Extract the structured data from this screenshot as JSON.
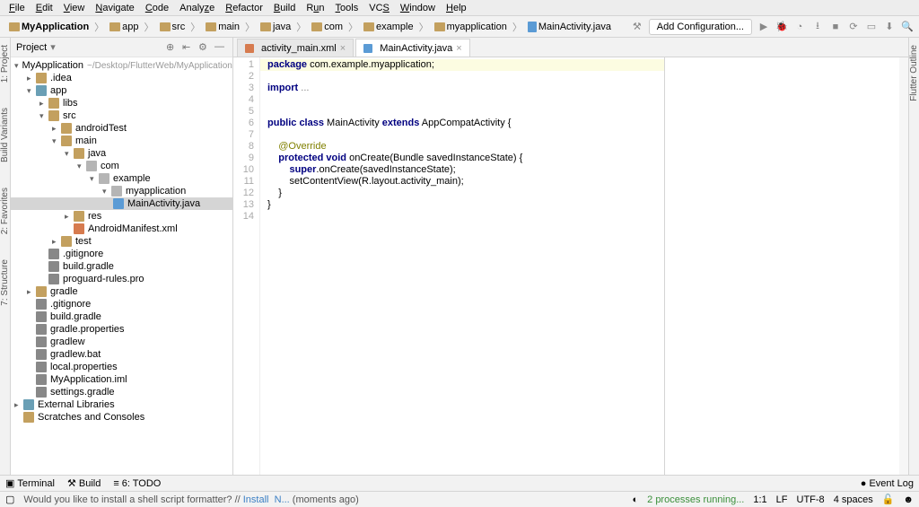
{
  "menu": [
    "File",
    "Edit",
    "View",
    "Navigate",
    "Code",
    "Analyze",
    "Refactor",
    "Build",
    "Run",
    "Tools",
    "VCS",
    "Window",
    "Help"
  ],
  "breadcrumbs": [
    "MyApplication",
    "app",
    "src",
    "main",
    "java",
    "com",
    "example",
    "myapplication",
    "MainActivity.java"
  ],
  "add_config": "Add Configuration...",
  "panel": {
    "title": "Project"
  },
  "tree": [
    {
      "d": 0,
      "c": "▾",
      "i": "module",
      "t": "MyApplication",
      "m": "~/Desktop/FlutterWeb/MyApplication"
    },
    {
      "d": 1,
      "c": "▸",
      "i": "folder",
      "t": ".idea"
    },
    {
      "d": 1,
      "c": "▾",
      "i": "module",
      "t": "app"
    },
    {
      "d": 2,
      "c": "▸",
      "i": "folder",
      "t": "libs"
    },
    {
      "d": 2,
      "c": "▾",
      "i": "folder",
      "t": "src"
    },
    {
      "d": 3,
      "c": "▸",
      "i": "folder",
      "t": "androidTest"
    },
    {
      "d": 3,
      "c": "▾",
      "i": "folder",
      "t": "main"
    },
    {
      "d": 4,
      "c": "▾",
      "i": "folder",
      "t": "java"
    },
    {
      "d": 5,
      "c": "▾",
      "i": "pkg",
      "t": "com"
    },
    {
      "d": 6,
      "c": "▾",
      "i": "pkg",
      "t": "example"
    },
    {
      "d": 7,
      "c": "▾",
      "i": "pkg",
      "t": "myapplication"
    },
    {
      "d": 8,
      "c": "",
      "i": "filej",
      "t": "MainActivity.java",
      "sel": true
    },
    {
      "d": 4,
      "c": "▸",
      "i": "folder",
      "t": "res"
    },
    {
      "d": 4,
      "c": "",
      "i": "filex",
      "t": "AndroidManifest.xml"
    },
    {
      "d": 3,
      "c": "▸",
      "i": "folder",
      "t": "test"
    },
    {
      "d": 2,
      "c": "",
      "i": "fileg",
      "t": ".gitignore"
    },
    {
      "d": 2,
      "c": "",
      "i": "fileg",
      "t": "build.gradle"
    },
    {
      "d": 2,
      "c": "",
      "i": "fileg",
      "t": "proguard-rules.pro"
    },
    {
      "d": 1,
      "c": "▸",
      "i": "folder",
      "t": "gradle"
    },
    {
      "d": 1,
      "c": "",
      "i": "fileg",
      "t": ".gitignore"
    },
    {
      "d": 1,
      "c": "",
      "i": "fileg",
      "t": "build.gradle"
    },
    {
      "d": 1,
      "c": "",
      "i": "fileg",
      "t": "gradle.properties"
    },
    {
      "d": 1,
      "c": "",
      "i": "fileg",
      "t": "gradlew"
    },
    {
      "d": 1,
      "c": "",
      "i": "fileg",
      "t": "gradlew.bat"
    },
    {
      "d": 1,
      "c": "",
      "i": "fileg",
      "t": "local.properties"
    },
    {
      "d": 1,
      "c": "",
      "i": "fileg",
      "t": "MyApplication.iml"
    },
    {
      "d": 1,
      "c": "",
      "i": "fileg",
      "t": "settings.gradle"
    },
    {
      "d": 0,
      "c": "▸",
      "i": "module",
      "t": "External Libraries"
    },
    {
      "d": 0,
      "c": "",
      "i": "folder",
      "t": "Scratches and Consoles"
    }
  ],
  "tabs": [
    {
      "label": "activity_main.xml",
      "icon": "filex"
    },
    {
      "label": "MainActivity.java",
      "icon": "filej",
      "active": true
    }
  ],
  "code": {
    "lines": [
      1,
      2,
      3,
      4,
      5,
      6,
      7,
      8,
      9,
      10,
      11,
      12,
      13,
      14
    ],
    "l1a": "package",
    "l1b": " com.example.myapplication;",
    "l3a": "import",
    "l3b": " ...",
    "l6a": "public class",
    "l6b": " MainActivity ",
    "l6c": "extends",
    "l6d": " AppCompatActivity {",
    "l8": "    @Override",
    "l9a": "    protected void",
    "l9b": " onCreate(Bundle savedInstanceState) {",
    "l10a": "        super",
    "l10b": ".onCreate(savedInstanceState);",
    "l11": "        setContentView(R.layout.activity_main);",
    "l12": "    }",
    "l13": "}"
  },
  "bottom": {
    "terminal": "Terminal",
    "build": "Build",
    "todo": "6: TODO",
    "eventlog": "Event Log"
  },
  "status": {
    "msg_pre": "Would you like to install a shell script formatter? // ",
    "install": "Install",
    "na": "N...",
    "time": " (moments ago)",
    "proc": "2 processes running...",
    "pos": "1:1",
    "le": "LF",
    "enc": "UTF-8",
    "indent": "4 spaces"
  },
  "left_tabs": [
    "1: Project",
    "7: Structure",
    "2: Favorites",
    "Build Variants"
  ],
  "right_tabs": [
    "Flutter Outline"
  ]
}
